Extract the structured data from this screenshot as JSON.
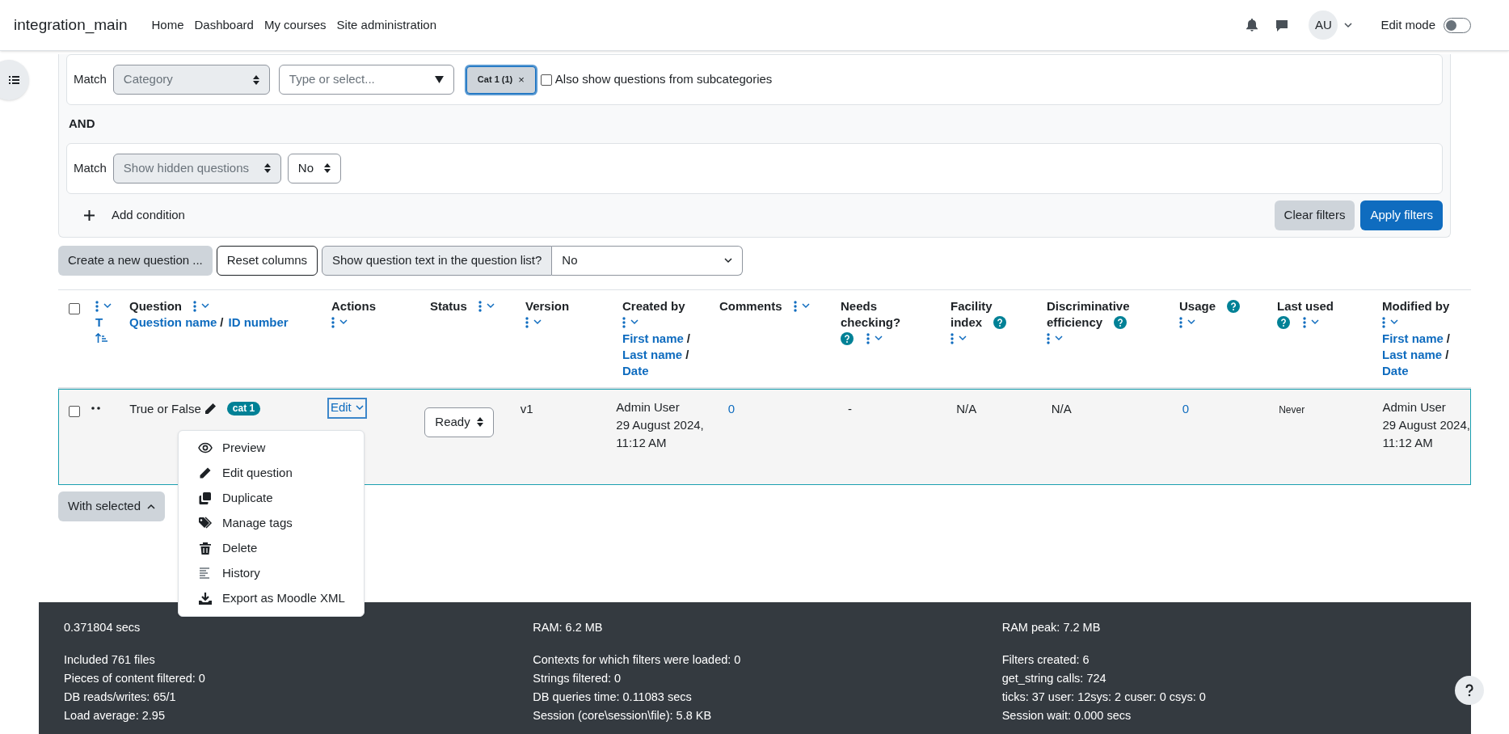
{
  "navbar": {
    "brand": "integration_main",
    "links": [
      "Home",
      "Dashboard",
      "My courses",
      "Site administration"
    ],
    "avatar": "AU",
    "edit_mode_label": "Edit mode",
    "edit_mode_on": false
  },
  "filters": {
    "conditions": [
      {
        "match_label": "Match",
        "field": "Category",
        "kind": "category",
        "placeholder": "Type or select...",
        "chip": "Cat 1 (1)",
        "chip_remove": "×",
        "subcategories_label": "Also show questions from subcategories",
        "subcategories_checked": false
      },
      {
        "match_label": "Match",
        "field": "Show hidden questions",
        "kind": "select",
        "value": "No"
      }
    ],
    "joiner": "AND",
    "add_condition": "Add condition",
    "clear": "Clear filters",
    "apply": "Apply filters"
  },
  "toolbar": {
    "create": "Create a new question ...",
    "reset": "Reset columns",
    "show_text_label": "Show question text in the question list?",
    "show_text_value": "No"
  },
  "table": {
    "select_all_checked": false,
    "columns": [
      {
        "lines": [
          [
            {
              "kind": "menu"
            }
          ],
          [
            {
              "kind": "link",
              "text": "T"
            }
          ],
          [
            {
              "kind": "sort"
            }
          ]
        ]
      },
      {
        "lines": [
          [
            {
              "kind": "title",
              "text": "Question"
            },
            {
              "kind": "menu"
            }
          ],
          [
            {
              "kind": "link",
              "text": "Question name"
            },
            {
              "kind": "sep",
              "text": "/"
            },
            {
              "kind": "link",
              "text": "ID number"
            }
          ]
        ]
      },
      {
        "lines": [
          [
            {
              "kind": "title",
              "text": "Actions"
            }
          ],
          [
            {
              "kind": "menu"
            }
          ]
        ]
      },
      {
        "lines": [
          [
            {
              "kind": "title",
              "text": "Status"
            },
            {
              "kind": "menu"
            }
          ]
        ]
      },
      {
        "lines": [
          [
            {
              "kind": "title",
              "text": "Version"
            }
          ],
          [
            {
              "kind": "menu"
            }
          ]
        ]
      },
      {
        "lines": [
          [
            {
              "kind": "title",
              "text": "Created by"
            }
          ],
          [
            {
              "kind": "menu"
            }
          ],
          [
            {
              "kind": "link",
              "text": "First name"
            },
            {
              "kind": "sep",
              "text": "/"
            }
          ],
          [
            {
              "kind": "link",
              "text": "Last name"
            },
            {
              "kind": "sep",
              "text": "/"
            }
          ],
          [
            {
              "kind": "link",
              "text": "Date"
            }
          ]
        ]
      },
      {
        "lines": [
          [
            {
              "kind": "title",
              "text": "Comments"
            },
            {
              "kind": "menu"
            }
          ]
        ]
      },
      {
        "lines": [
          [
            {
              "kind": "title",
              "text": "Needs"
            }
          ],
          [
            {
              "kind": "title",
              "text": "checking?"
            }
          ],
          [
            {
              "kind": "help"
            },
            {
              "kind": "menu"
            }
          ]
        ]
      },
      {
        "lines": [
          [
            {
              "kind": "title",
              "text": "Facility"
            }
          ],
          [
            {
              "kind": "title",
              "text": "index"
            },
            {
              "kind": "help"
            }
          ],
          [
            {
              "kind": "menu"
            }
          ]
        ]
      },
      {
        "lines": [
          [
            {
              "kind": "title",
              "text": "Discriminative"
            }
          ],
          [
            {
              "kind": "title",
              "text": "efficiency"
            },
            {
              "kind": "help"
            }
          ],
          [
            {
              "kind": "menu"
            }
          ]
        ]
      },
      {
        "lines": [
          [
            {
              "kind": "title",
              "text": "Usage"
            },
            {
              "kind": "help"
            }
          ],
          [
            {
              "kind": "menu"
            }
          ]
        ]
      },
      {
        "lines": [
          [
            {
              "kind": "title",
              "text": "Last used"
            }
          ],
          [
            {
              "kind": "help"
            },
            {
              "kind": "menu"
            }
          ]
        ]
      },
      {
        "lines": [
          [
            {
              "kind": "title",
              "text": "Modified by"
            }
          ],
          [
            {
              "kind": "menu"
            }
          ],
          [
            {
              "kind": "link",
              "text": "First name"
            },
            {
              "kind": "sep",
              "text": "/"
            }
          ],
          [
            {
              "kind": "link",
              "text": "Last name"
            },
            {
              "kind": "sep",
              "text": "/"
            }
          ],
          [
            {
              "kind": "link",
              "text": "Date"
            }
          ]
        ]
      }
    ],
    "rows": [
      {
        "checked": false,
        "highlighted": true,
        "name": "True or False",
        "tag": "cat 1",
        "action": "Edit",
        "menu_expanded": true,
        "status": "Ready",
        "version": "v1",
        "created_by": "Admin User",
        "created_date": "29 August 2024, 11:12 AM",
        "comments": "0",
        "needs_checking": "-",
        "facility": "N/A",
        "discriminative": "N/A",
        "usage": "0",
        "last_used": "Never",
        "modified_by": "Admin User",
        "modified_date": "29 August 2024, 11:12 AM"
      }
    ]
  },
  "action_menu": [
    {
      "kind": "eye",
      "label": "Preview"
    },
    {
      "kind": "pencil",
      "label": "Edit question"
    },
    {
      "kind": "copy",
      "label": "Duplicate"
    },
    {
      "kind": "tags",
      "label": "Manage tags"
    },
    {
      "kind": "trash",
      "label": "Delete"
    },
    {
      "kind": "history",
      "label": "History"
    },
    {
      "kind": "download",
      "label": "Export as Moodle XML"
    }
  ],
  "with_selected": "With selected",
  "footer": {
    "columns": [
      {
        "headline": "0.371804 secs",
        "lines": [
          "Included 761 files",
          "Pieces of content filtered: 0",
          "DB reads/writes: 65/1",
          "Load average: 2.95"
        ]
      },
      {
        "headline": "RAM: 6.2 MB",
        "lines": [
          "Contexts for which filters were loaded: 0",
          "Strings filtered: 0",
          "DB queries time: 0.11083 secs",
          "Session (core\\session\\file): 5.8 KB"
        ]
      },
      {
        "headline": "RAM peak: 7.2 MB",
        "lines": [
          "Filters created: 6",
          "get_string calls: 724",
          "ticks: 37 user: 12sys: 2 cuser: 0 csys: 0",
          "Session wait: 0.000 secs"
        ]
      }
    ]
  }
}
